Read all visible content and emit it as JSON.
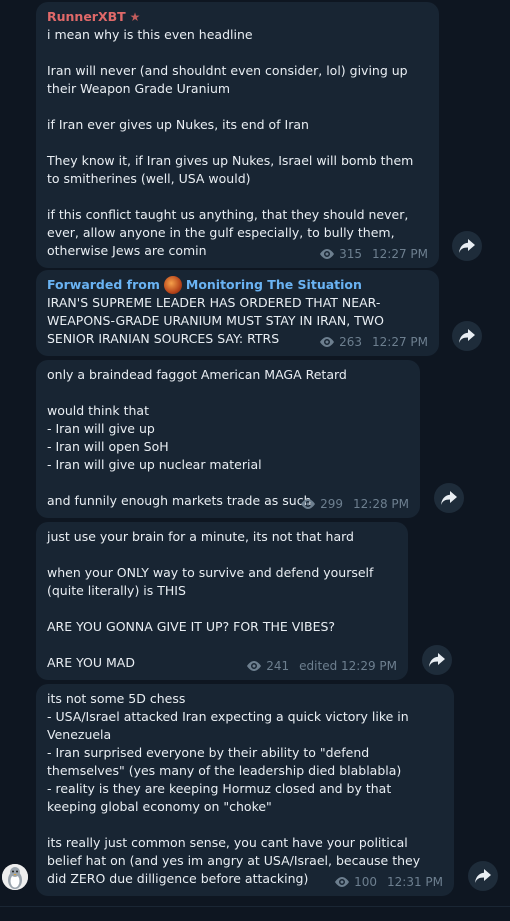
{
  "messages": [
    {
      "author": "RunnerXBT",
      "text": "i mean why is this even headline\n\nIran will never (and shouldnt even consider, lol) giving up their Weapon Grade Uranium\n\nif Iran ever gives up Nukes, its end of Iran\n\nThey know it, if Iran gives up Nukes, Israel will bomb them to smitherines (well, USA would)\n\nif this conflict taught us anything, that they should never, ever, allow anyone in the gulf especially, to bully them, otherwise Jews are comin",
      "views": "315",
      "time": "12:27 PM"
    },
    {
      "forwarded_prefix": "Forwarded from",
      "forwarded_source": "Monitoring The Situation",
      "text": "IRAN'S SUPREME LEADER HAS ORDERED THAT NEAR-WEAPONS-GRADE URANIUM MUST STAY IN IRAN, TWO SENIOR IRANIAN SOURCES SAY: RTRS",
      "views": "263",
      "time": "12:27 PM"
    },
    {
      "text": "only a braindead faggot American MAGA Retard\n\nwould think that\n- Iran will give up\n- Iran will open SoH\n- Iran will give up nuclear material\n\nand funnily enough markets trade as such",
      "views": "299",
      "time": "12:28 PM"
    },
    {
      "text": "just use your brain for a minute, its not that hard\n\nwhen your ONLY way to survive and defend yourself (quite literally) is THIS\n\nARE YOU GONNA GIVE IT UP? FOR THE VIBES?\n\nARE YOU MAD",
      "views": "241",
      "time": "edited 12:29 PM"
    },
    {
      "text": "its not some 5D chess\n- USA/Israel attacked Iran expecting a quick victory like in Venezuela\n- Iran surprised everyone by their ability to \"defend themselves\" (yes many of the leadership died blablabla)\n- reality is they are keeping Hormuz closed and by that keeping global economy on \"choke\"\n\nits really just common sense, you cant have your political belief hat on (and yes im angry at USA/Israel, because they did ZERO due dilligence before attacking)",
      "views": "100",
      "time": "12:31 PM"
    }
  ],
  "icons": {
    "view": "eye-icon",
    "share": "share-arrow-icon",
    "author_badge": "star-icon"
  },
  "colors": {
    "background": "#0e1621",
    "bubble": "#182533",
    "author": "#e06969",
    "forward": "#6ab3f3",
    "meta": "#6d7f8f"
  }
}
